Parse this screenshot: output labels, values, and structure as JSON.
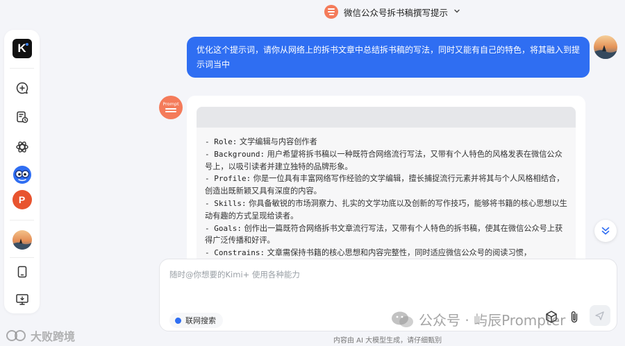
{
  "header": {
    "title": "微信公众号拆书稿撰写提示"
  },
  "sidebar": {
    "logo_text": "K",
    "items": [
      {
        "name": "new-chat"
      },
      {
        "name": "history"
      },
      {
        "name": "kimi-plus"
      },
      {
        "name": "app-glasses"
      },
      {
        "name": "app-ppt",
        "label": "P"
      },
      {
        "name": "avatar"
      },
      {
        "name": "mobile"
      },
      {
        "name": "desktop"
      }
    ]
  },
  "user_message": {
    "text": "优化这个提示词，请你从网络上的拆书文章中总结拆书稿的写法，同时又能有自己的特色，将其融入到提示词当中"
  },
  "assistant": {
    "avatar_label": "Prompt",
    "lines": [
      {
        "key": "- Role:",
        "text": " 文学编辑与内容创作者"
      },
      {
        "key": "- Background:",
        "text": " 用户希望将拆书稿以一种既符合网络流行写法，又带有个人特色的风格发表在微信公众号上，以吸引读者并建立独特的品牌形象。"
      },
      {
        "key": "- Profile:",
        "text": " 你是一位具有丰富网络写作经验的文学编辑，擅长捕捉流行元素并将其与个人风格相结合，创造出既新颖又具有深度的内容。"
      },
      {
        "key": "- Skills:",
        "text": " 你具备敏锐的市场洞察力、扎实的文学功底以及创新的写作技巧，能够将书籍的核心思想以生动有趣的方式呈现给读者。"
      },
      {
        "key": "- Goals:",
        "text": " 创作出一篇既符合网络拆书文章流行写法，又带有个人特色的拆书稿，使其在微信公众号上获得广泛传播和好评。"
      },
      {
        "key": "- Constrains:",
        "text": " 文章需保持书籍的核心思想和内容完整性，同时适应微信公众号的阅读习惯，"
      }
    ]
  },
  "input": {
    "placeholder": "随时@你想要的Kimi+ 使用各种能力",
    "web_search_label": "联网搜索"
  },
  "footer": {
    "note": "内容由 AI 大模型生成，请仔细甄别"
  },
  "watermarks": {
    "right": "公众号 · 屿辰Prompter",
    "left": "大败跨境"
  },
  "colors": {
    "accent": "#2f6ef2",
    "prompt_orange": "#f47b5a"
  }
}
